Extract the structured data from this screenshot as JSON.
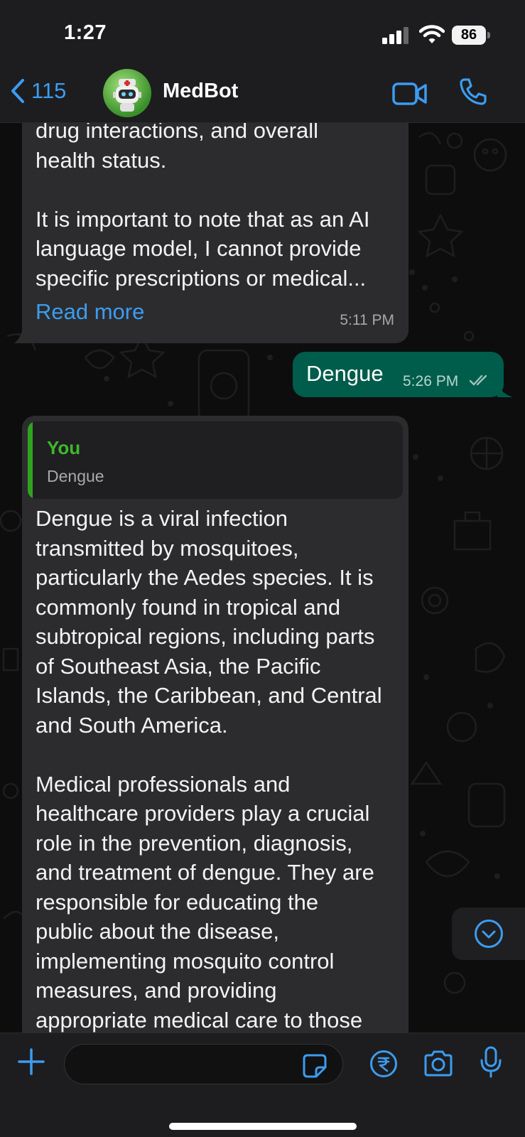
{
  "status_bar": {
    "time": "1:27",
    "battery": "86"
  },
  "header": {
    "back_count": "115",
    "contact_name": "MedBot"
  },
  "messages": [
    {
      "direction": "incoming",
      "text": "drug interactions, and overall\nhealth status.\n\nIt is important to note that as an AI\nlanguage model, I cannot provide\nspecific prescriptions or medical...",
      "read_more": "Read more",
      "time": "5:11 PM"
    },
    {
      "direction": "outgoing",
      "text": "Dengue",
      "time": "5:26 PM"
    },
    {
      "direction": "incoming",
      "quote": {
        "author": "You",
        "text": "Dengue"
      },
      "text": "Dengue is a viral infection\ntransmitted by mosquitoes,\nparticularly the Aedes species. It is\ncommonly found in tropical and\nsubtropical regions, including parts\nof Southeast Asia, the Pacific\nIslands, the Caribbean, and Central\nand South America.\n\nMedical professionals and\nhealthcare providers play a crucial\nrole in the prevention, diagnosis,\nand treatment of dengue. They are\nresponsible for educating the\npublic about the disease,\nimplementing mosquito control\nmeasures, and providing\nappropriate medical care to those"
    }
  ],
  "colors": {
    "accent": "#3c9cf0",
    "incoming_bubble": "#2c2c2e",
    "outgoing_bubble": "#005c4b",
    "quote_accent": "#3fb82b"
  },
  "icons": [
    "back-chevron-icon",
    "video-call-icon",
    "phone-icon",
    "scroll-down-icon",
    "plus-icon",
    "sticker-icon",
    "rupee-icon",
    "camera-icon",
    "microphone-icon"
  ]
}
